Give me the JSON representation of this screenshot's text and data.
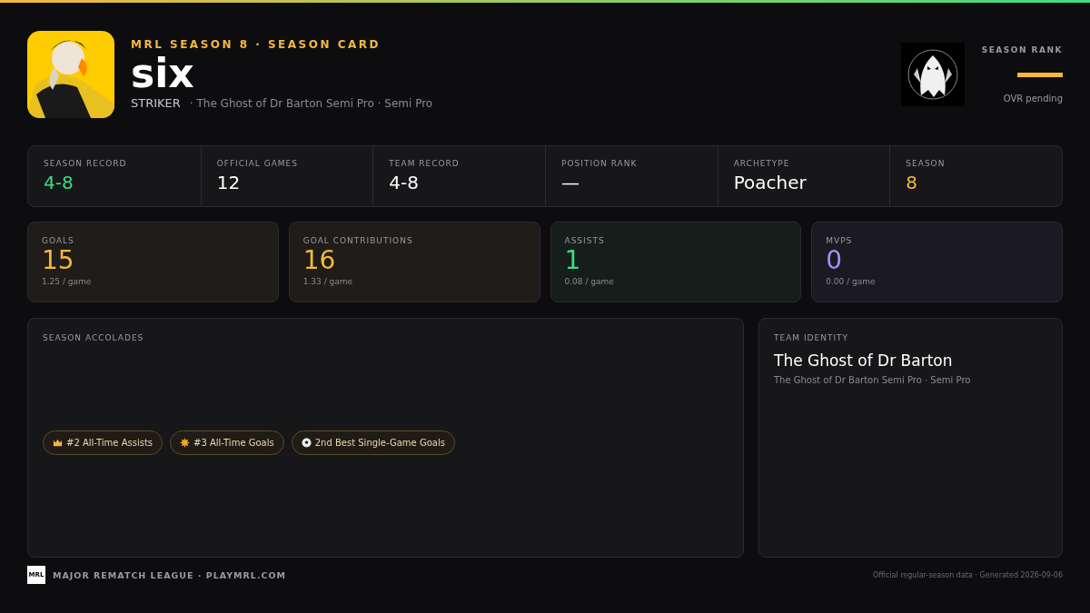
{
  "header": {
    "eyebrow": "MRL SEASON 8 · SEASON CARD",
    "player_name": "six",
    "position": "STRIKER",
    "team_line": "· The Ghost of Dr Barton Semi Pro · Semi Pro"
  },
  "season_rank": {
    "label": "SEASON RANK",
    "note": "OVR pending"
  },
  "summary": [
    {
      "label": "SEASON RECORD",
      "value": "4-8",
      "color": "#3ddc84"
    },
    {
      "label": "OFFICIAL GAMES",
      "value": "12",
      "color": "#ffffff"
    },
    {
      "label": "TEAM RECORD",
      "value": "4-8",
      "color": "#ffffff"
    },
    {
      "label": "POSITION RANK",
      "value": "—",
      "color": "#ffffff"
    },
    {
      "label": "ARCHETYPE",
      "value": "Poacher",
      "color": "#ffffff"
    },
    {
      "label": "SEASON",
      "value": "8",
      "color": "#f5b83d"
    }
  ],
  "stat_cards": [
    {
      "label": "GOALS",
      "value": "15",
      "per_game": "1.25 / game",
      "color": "#f5b83d"
    },
    {
      "label": "GOAL CONTRIBUTIONS",
      "value": "16",
      "per_game": "1.33 / game",
      "color": "#f5b83d"
    },
    {
      "label": "ASSISTS",
      "value": "1",
      "per_game": "0.08 / game",
      "color": "#3ddc84"
    },
    {
      "label": "MVPS",
      "value": "0",
      "per_game": "0.00 / game",
      "color": "#a78bfa"
    }
  ],
  "accolades": {
    "title": "SEASON ACCOLADES",
    "items": [
      {
        "kind": "crown",
        "label": "#2 All-Time Assists"
      },
      {
        "kind": "star",
        "label": "#3 All-Time Goals"
      },
      {
        "kind": "ball",
        "label": "2nd Best Single-Game Goals"
      }
    ]
  },
  "team_identity": {
    "title": "TEAM IDENTITY",
    "name": "The Ghost of Dr Barton",
    "subtitle": "The Ghost of Dr Barton Semi Pro · Semi Pro"
  },
  "footer": {
    "logo_text": "MRL",
    "league": "MAJOR REMATCH LEAGUE · PLAYMRL.COM",
    "note": "Official regular-season data · Generated 2026-09-06"
  }
}
